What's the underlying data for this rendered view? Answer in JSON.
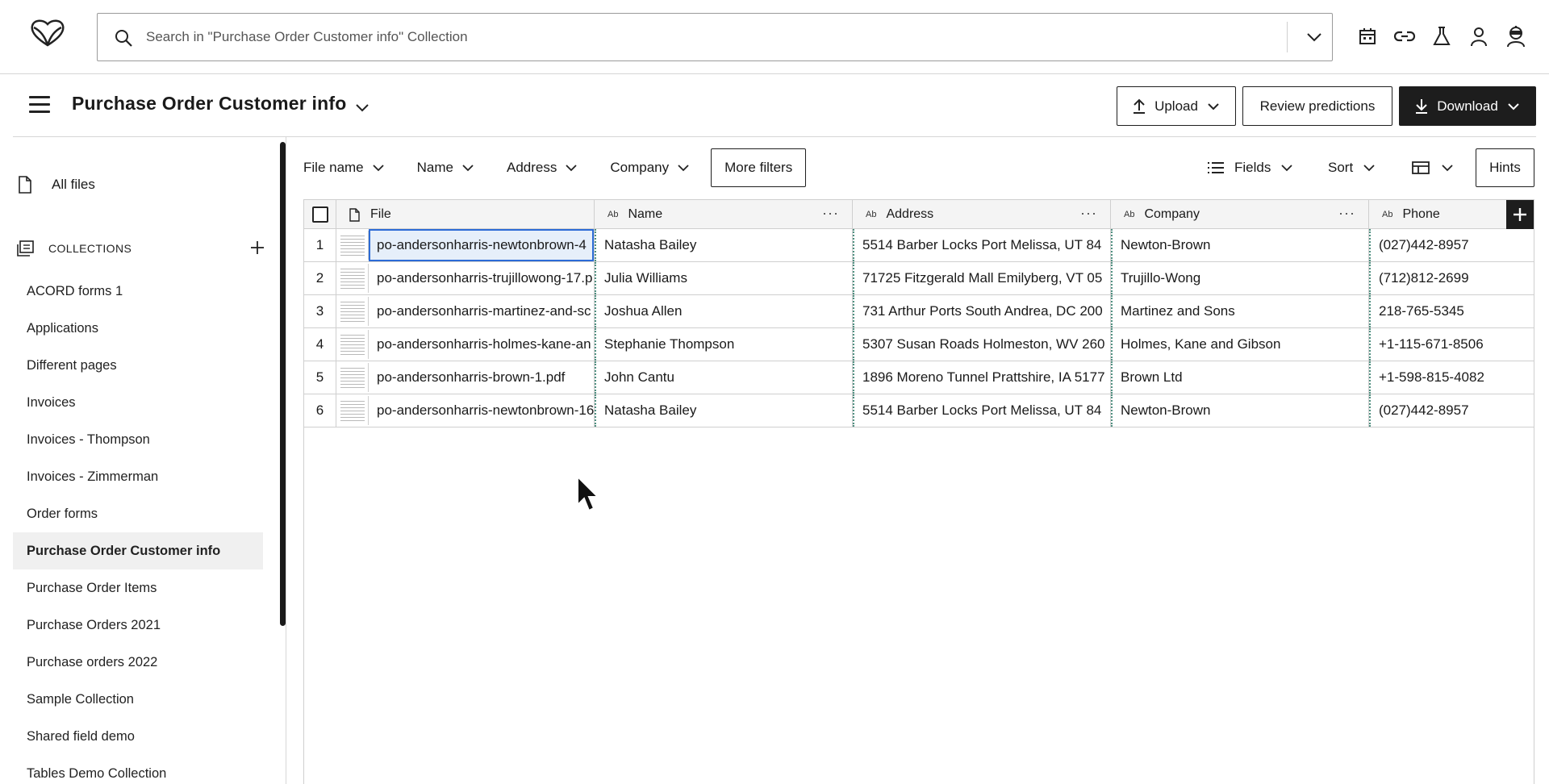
{
  "search": {
    "placeholder": "Search in \"Purchase Order Customer info\" Collection"
  },
  "header_icons": [
    "calendar-icon",
    "link-icon",
    "flask-icon",
    "user-icon",
    "robot-icon"
  ],
  "page": {
    "title": "Purchase Order Customer info"
  },
  "actions": {
    "upload": "Upload",
    "review": "Review predictions",
    "download": "Download"
  },
  "sidebar": {
    "all_files": "All files",
    "collections_label": "COLLECTIONS",
    "items": [
      "ACORD forms 1",
      "Applications",
      "Different pages",
      "Invoices",
      "Invoices - Thompson",
      "Invoices - Zimmerman",
      "Order forms",
      "Purchase Order Customer info",
      "Purchase Order Items",
      "Purchase Orders 2021",
      "Purchase orders 2022",
      "Sample Collection",
      "Shared field demo",
      "Tables Demo Collection"
    ],
    "active_index": 7
  },
  "filters": [
    "File name",
    "Name",
    "Address",
    "Company"
  ],
  "more_filters": "More filters",
  "tools": {
    "fields": "Fields",
    "sort": "Sort",
    "hints": "Hints"
  },
  "table": {
    "columns": [
      "File",
      "Name",
      "Address",
      "Company",
      "Phone"
    ],
    "type_badge": "Ab",
    "rows": [
      {
        "n": "1",
        "file": "po-andersonharris-newtonbrown-4",
        "name": "Natasha Bailey",
        "address": "5514 Barber Locks Port Melissa, UT 84",
        "company": "Newton-Brown",
        "phone": "(027)442-8957"
      },
      {
        "n": "2",
        "file": "po-andersonharris-trujillowong-17.p",
        "name": "Julia Williams",
        "address": "71725 Fitzgerald Mall Emilyberg, VT 05",
        "company": "Trujillo-Wong",
        "phone": "(712)812-2699"
      },
      {
        "n": "3",
        "file": "po-andersonharris-martinez-and-sc",
        "name": "Joshua Allen",
        "address": "731 Arthur Ports South Andrea, DC 200",
        "company": "Martinez and Sons",
        "phone": "218-765-5345"
      },
      {
        "n": "4",
        "file": "po-andersonharris-holmes-kane-an",
        "name": "Stephanie Thompson",
        "address": "5307 Susan Roads Holmeston, WV 260",
        "company": "Holmes, Kane and Gibson",
        "phone": "+1-115-671-8506"
      },
      {
        "n": "5",
        "file": "po-andersonharris-brown-1.pdf",
        "name": "John Cantu",
        "address": "1896 Moreno Tunnel Prattshire, IA 5177",
        "company": "Brown Ltd",
        "phone": "+1-598-815-4082"
      },
      {
        "n": "6",
        "file": "po-andersonharris-newtonbrown-16",
        "name": "Natasha Bailey",
        "address": "5514 Barber Locks Port Melissa, UT 84",
        "company": "Newton-Brown",
        "phone": "(027)442-8957"
      }
    ]
  }
}
